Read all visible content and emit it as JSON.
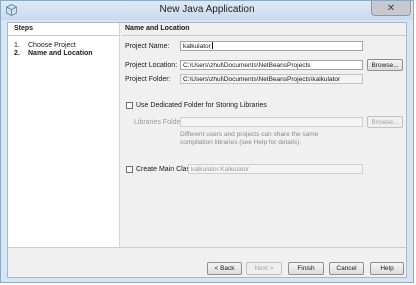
{
  "window": {
    "title": "New Java Application",
    "close_glyph": "✕"
  },
  "steps": {
    "heading": "Steps",
    "items": [
      {
        "num": "1.",
        "label": "Choose Project"
      },
      {
        "num": "2.",
        "label": "Name and Location"
      }
    ],
    "active_index": 1
  },
  "main": {
    "heading": "Name and Location",
    "project_name": {
      "label": "Project Name:",
      "value": "kalkulator"
    },
    "project_location": {
      "label": "Project Location:",
      "value": "C:\\Users\\zhul\\Documents\\NetBeansProjects",
      "browse_label": "Browse..."
    },
    "project_folder": {
      "label": "Project Folder:",
      "value": "C:\\Users\\zhul\\Documents\\NetBeansProjects\\kalkulator"
    },
    "dedicated_folder": {
      "label": "Use Dedicated Folder for Storing Libraries",
      "checked": false
    },
    "libraries_folder": {
      "label": "Libraries Folder:",
      "value": "",
      "browse_label": "Browse..."
    },
    "libraries_help": "Different users and projects can share the same compilation libraries (see Help for details).",
    "main_class": {
      "label": "Create Main Class",
      "checked": false,
      "value": "kalkulator.Kalkulator"
    }
  },
  "footer": {
    "back_label": "< Back",
    "next_label": "Next >",
    "finish_label": "Finish",
    "cancel_label": "Cancel",
    "help_label": "Help"
  }
}
